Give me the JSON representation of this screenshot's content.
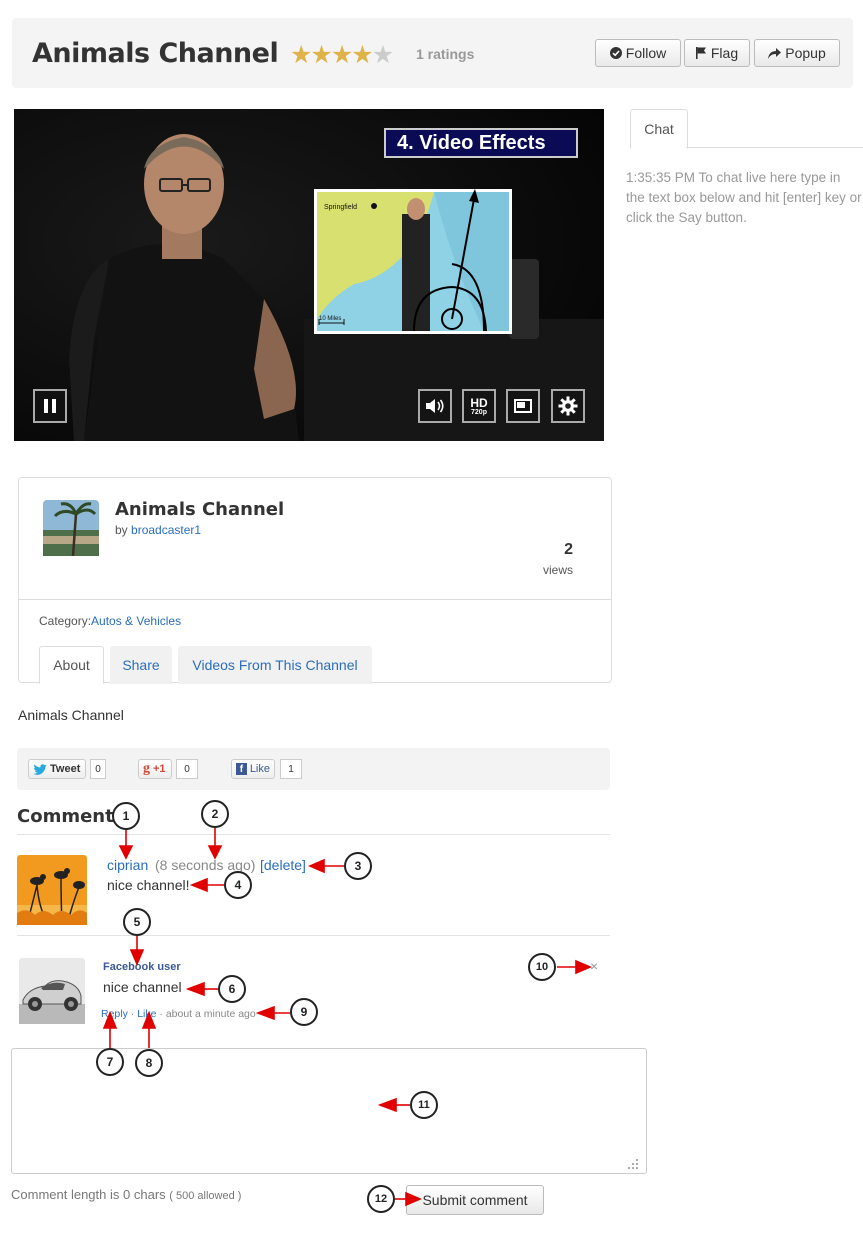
{
  "header": {
    "title": "Animals Channel",
    "rating_count_label": "1 ratings",
    "rating": 4,
    "rating_max": 5,
    "follow_label": "Follow",
    "flag_label": "Flag",
    "popup_label": "Popup"
  },
  "video": {
    "overlay_title": "4. Video Effects",
    "hd_label": "HD",
    "hd_quality": "720p",
    "map_labels": {
      "city": "Springfield",
      "scale": "10 Miles"
    }
  },
  "chat": {
    "tab_label": "Chat",
    "message": "1:35:35 PM To chat live here type in the text box below and hit [enter] key or click the Say button."
  },
  "channel": {
    "title": "Animals Channel",
    "by_prefix": "by",
    "broadcaster": "broadcaster1",
    "views_count": "2",
    "views_label": "views",
    "category_label": "Category:",
    "category": "Autos & Vehicles",
    "tabs": [
      {
        "label": "About"
      },
      {
        "label": "Share"
      },
      {
        "label": "Videos From This Channel"
      }
    ],
    "about_text": "Animals Channel"
  },
  "social": {
    "tweet_label": "Tweet",
    "tweet_count": "0",
    "gplus_label": "+1",
    "gplus_count": "0",
    "like_label": "Like",
    "like_count": "1"
  },
  "comments": {
    "title": "Comments",
    "items": [
      {
        "author": "ciprian",
        "time": "(8 seconds ago)",
        "delete_label": "[delete]",
        "text": "nice channel!"
      }
    ],
    "facebook": {
      "user": "Facebook user",
      "text": "nice channel",
      "reply_label": "Reply",
      "like_label": "Like",
      "time": "about a minute ago",
      "close_glyph": "×"
    },
    "length_prefix": "Comment length is",
    "length_value": "0 chars",
    "length_allowed": "( 500 allowed )",
    "submit_label": "Submit comment"
  },
  "annotations": [
    "1",
    "2",
    "3",
    "4",
    "5",
    "6",
    "7",
    "8",
    "9",
    "10",
    "11",
    "12"
  ],
  "colors": {
    "link": "#2a6ebb",
    "star": "#e0b34a",
    "arrow": "#e00000",
    "facebook": "#3b5998"
  }
}
